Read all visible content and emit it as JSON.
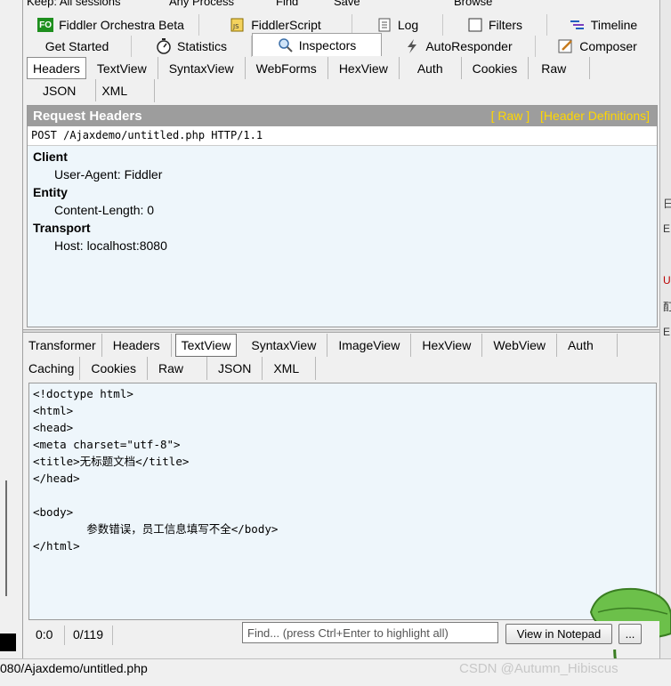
{
  "toolbar": {
    "keep_label": "Keep: All sessions",
    "process_label": "Any Process",
    "find_label": "Find",
    "save_label": "Save",
    "browse_label": "Browse"
  },
  "main_tabs": {
    "row1": [
      {
        "label": "Fiddler Orchestra Beta",
        "icon": "fiddler-orchestra-icon"
      },
      {
        "label": "FiddlerScript",
        "icon": "script-icon"
      },
      {
        "label": "Log",
        "icon": "log-icon"
      },
      {
        "label": "Filters",
        "icon": "checkbox-icon"
      },
      {
        "label": "Timeline",
        "icon": "timeline-icon"
      }
    ],
    "row2": [
      {
        "label": "Get Started",
        "icon": ""
      },
      {
        "label": "Statistics",
        "icon": "stopwatch-icon"
      },
      {
        "label": "Inspectors",
        "icon": "inspector-icon",
        "active": true
      },
      {
        "label": "AutoResponder",
        "icon": "lightning-icon"
      },
      {
        "label": "Composer",
        "icon": "pencil-icon"
      }
    ]
  },
  "request": {
    "tabs": [
      "Headers",
      "TextView",
      "SyntaxView",
      "WebForms",
      "HexView",
      "Auth",
      "Cookies",
      "Raw",
      "JSON",
      "XML"
    ],
    "active_tab": "Headers",
    "title": "Request Headers",
    "raw_link": "[ Raw ]",
    "defs_link": "[Header Definitions]",
    "request_line": "POST /Ajaxdemo/untitled.php HTTP/1.1",
    "groups": [
      {
        "name": "Client",
        "items": [
          "User-Agent: Fiddler"
        ]
      },
      {
        "name": "Entity",
        "items": [
          "Content-Length: 0"
        ]
      },
      {
        "name": "Transport",
        "items": [
          "Host: localhost:8080"
        ]
      }
    ]
  },
  "response": {
    "tabs": [
      "Transformer",
      "Headers",
      "TextView",
      "SyntaxView",
      "ImageView",
      "HexView",
      "WebView",
      "Auth",
      "Caching",
      "Cookies",
      "Raw",
      "JSON",
      "XML"
    ],
    "active_tab": "TextView",
    "body": "<!doctype html>\n<html>\n<head>\n<meta charset=\"utf-8\">\n<title>无标题文档</title>\n</head>\n\n<body>\n\t参数错误，员工信息填写不全</body>\n</html>",
    "cursor_pos": "0:0",
    "char_count": "0/119",
    "find_placeholder": "Find... (press Ctrl+Enter to highlight all)",
    "view_notepad": "View in Notepad",
    "more": "..."
  },
  "status": {
    "url": "080/Ajaxdemo/untitled.php",
    "watermark": "CSDN @Autumn_Hibiscus"
  },
  "right_fragments": [
    "日",
    "E",
    "U",
    "酊",
    "E"
  ]
}
